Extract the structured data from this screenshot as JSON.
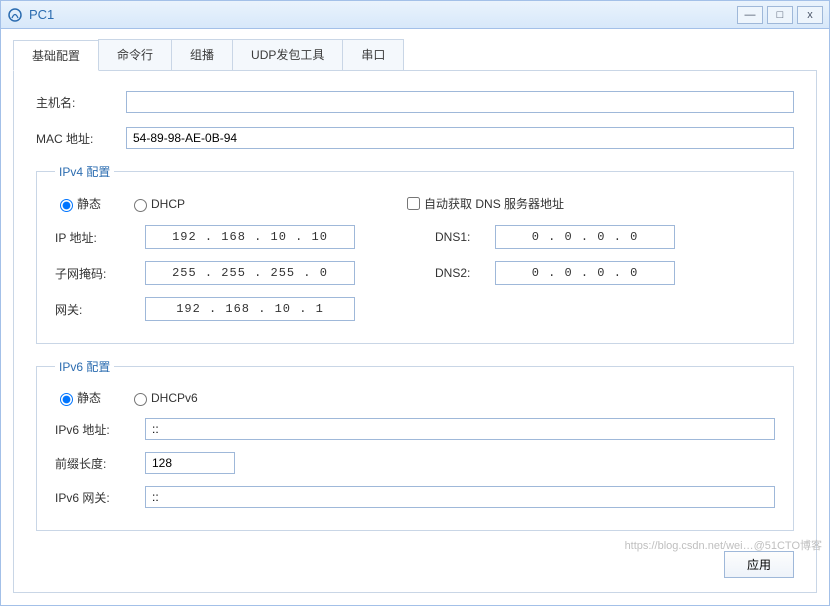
{
  "window": {
    "title": "PC1"
  },
  "win_buttons": {
    "min": "—",
    "max": "□",
    "close": "x"
  },
  "tabs": [
    "基础配置",
    "命令行",
    "组播",
    "UDP发包工具",
    "串口"
  ],
  "basic": {
    "hostname_label": "主机名:",
    "hostname": "",
    "mac_label": "MAC 地址:",
    "mac": "54-89-98-AE-0B-94"
  },
  "ipv4": {
    "legend": "IPv4 配置",
    "radio_static": "静态",
    "radio_dhcp": "DHCP",
    "auto_dns_label": "自动获取 DNS 服务器地址",
    "ip_label": "IP 地址:",
    "ip": "192  .  168  .   10   .   10",
    "mask_label": "子网掩码:",
    "mask": "255  .  255  .  255  .   0",
    "gw_label": "网关:",
    "gw": "192  .  168  .   10   .   1",
    "dns1_label": "DNS1:",
    "dns1": "0   .   0   .   0   .   0",
    "dns2_label": "DNS2:",
    "dns2": "0   .   0   .   0   .   0"
  },
  "ipv6": {
    "legend": "IPv6 配置",
    "radio_static": "静态",
    "radio_dhcp": "DHCPv6",
    "addr_label": "IPv6 地址:",
    "addr": "::",
    "prefix_label": "前缀长度:",
    "prefix": "128",
    "gw_label": "IPv6 网关:",
    "gw": "::"
  },
  "apply_label": "应用",
  "watermark": "https://blog.csdn.net/wei…@51CTO博客"
}
